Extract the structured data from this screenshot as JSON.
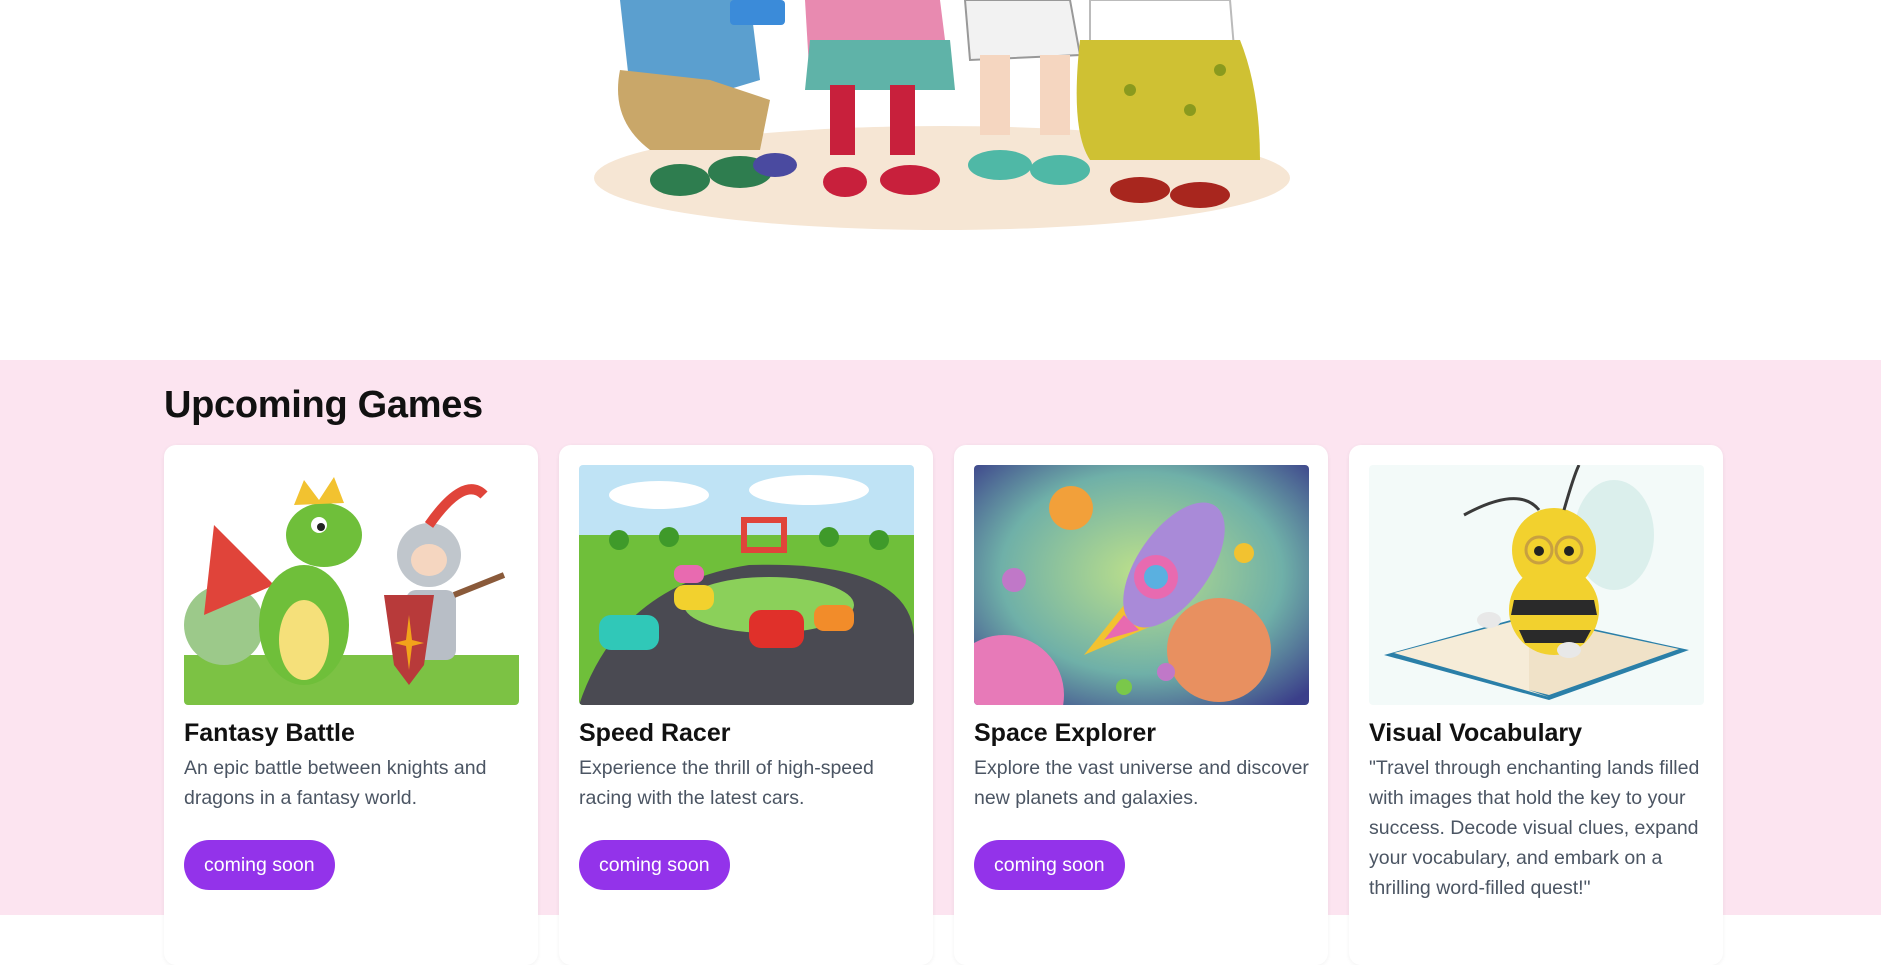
{
  "hero": {
    "illustration": "children-reading-books-illustration"
  },
  "games_section": {
    "title": "Upcoming Games",
    "cards": [
      {
        "title": "Fantasy Battle",
        "description": "An epic battle between knights and dragons in a fantasy world.",
        "button": "coming soon",
        "image": "dragon-and-knight-illustration"
      },
      {
        "title": "Speed Racer",
        "description": "Experience the thrill of high-speed racing with the latest cars.",
        "button": "coming soon",
        "image": "race-cars-on-track-illustration"
      },
      {
        "title": "Space Explorer",
        "description": "Explore the vast universe and discover new planets and galaxies.",
        "button": "coming soon",
        "image": "rocket-in-space-illustration"
      },
      {
        "title": "Visual Vocabulary",
        "description": "\"Travel through enchanting lands filled with images that hold the key to your success. Decode visual clues, expand your vocabulary, and embark on a thrilling word-filled quest!\"",
        "image": "bee-reading-book-illustration"
      }
    ]
  },
  "colors": {
    "section_bg": "#fce4f0",
    "button_bg": "#9333ea",
    "card_bg": "#ffffff"
  }
}
